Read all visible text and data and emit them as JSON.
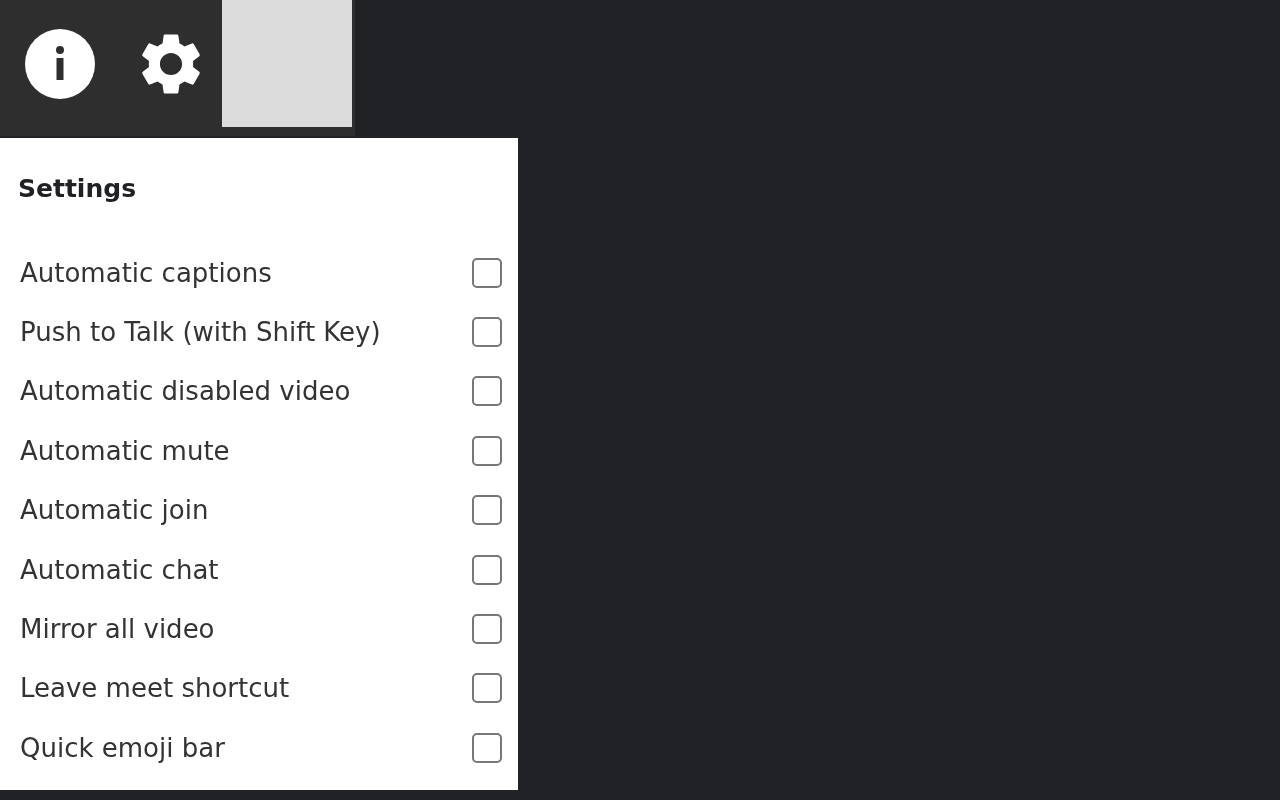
{
  "settings": {
    "title": "Settings",
    "options": [
      {
        "label": "Automatic captions",
        "checked": false
      },
      {
        "label": "Push to Talk (with Shift Key)",
        "checked": false
      },
      {
        "label": "Automatic disabled video",
        "checked": false
      },
      {
        "label": "Automatic mute",
        "checked": false
      },
      {
        "label": "Automatic join",
        "checked": false
      },
      {
        "label": "Automatic chat",
        "checked": false
      },
      {
        "label": "Mirror all video",
        "checked": false
      },
      {
        "label": "Leave meet shortcut",
        "checked": false
      },
      {
        "label": "Quick emoji bar",
        "checked": false
      }
    ]
  }
}
